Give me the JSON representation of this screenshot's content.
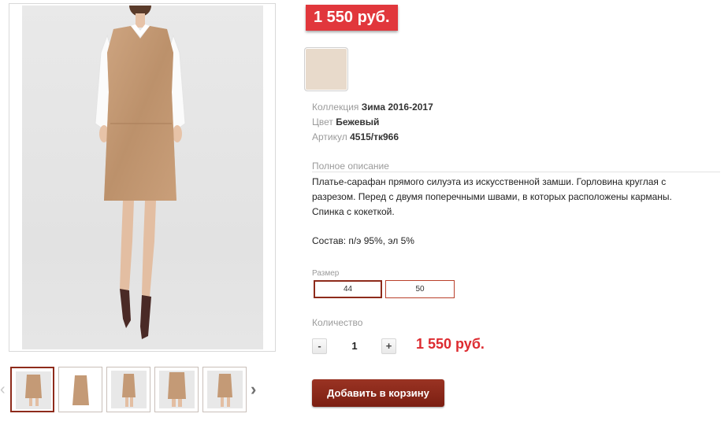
{
  "price_badge": "1 550 руб.",
  "color_swatch": "#e8dacb",
  "attributes": [
    {
      "label": "Коллекция",
      "value": "Зима 2016-2017"
    },
    {
      "label": "Цвет",
      "value": "Бежевый"
    },
    {
      "label": "Артикул",
      "value": "4515/тк966"
    }
  ],
  "description": {
    "title": "Полное описание",
    "lines": [
      "Платье-сарафан прямого силуэта из искусственной замши. Горловина круглая с",
      "разрезом. Перед с двумя поперечными швами, в которых расположены карманы.",
      "Спинка с кокеткой."
    ],
    "composition": "Состав: п/э 95%, эл 5%"
  },
  "size": {
    "title": "Размер",
    "options": [
      "44",
      "50"
    ],
    "selected": "44"
  },
  "quantity": {
    "title": "Количество",
    "minus": "-",
    "value": "1",
    "plus": "+",
    "total": "1 550 руб."
  },
  "add_to_cart": "Добавить в корзину",
  "gallery": {
    "prev_icon": "‹",
    "next_icon": "›",
    "thumb_count": 5
  }
}
